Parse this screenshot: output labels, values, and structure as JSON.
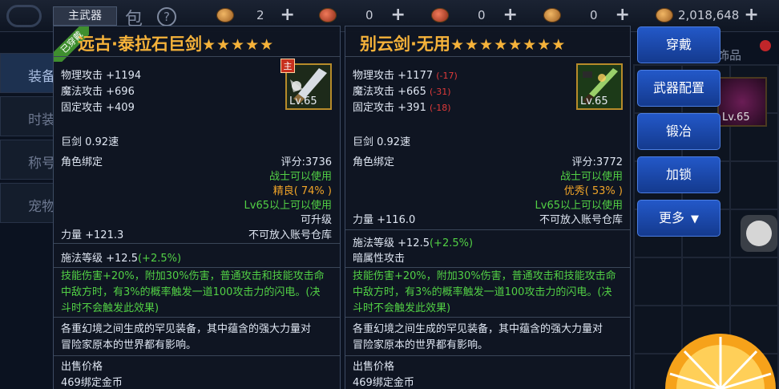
{
  "topbar": {
    "bag_label": "包",
    "help_label": "?",
    "currencies": [
      {
        "value": "2",
        "plus": "+"
      },
      {
        "value": "0",
        "plus": "+"
      },
      {
        "value": "0",
        "plus": "+"
      },
      {
        "value": "0",
        "plus": "+"
      },
      {
        "value": "2,018,648",
        "plus": "+"
      }
    ]
  },
  "leftnav": {
    "tabs": [
      {
        "label": "装备"
      },
      {
        "label": "时装"
      },
      {
        "label": "称号"
      },
      {
        "label": "宠物"
      }
    ]
  },
  "background": {
    "tag": "饰品",
    "item_level": "Lv.65"
  },
  "equipped_tab": "主武器",
  "left_item": {
    "ribbon": "已穿戴",
    "name": "远古·泰拉石巨剑",
    "stars": "★★★★★",
    "main_badge": "主",
    "level": "Lv.65",
    "stats": [
      "物理攻击 +1194",
      "魔法攻击 +696",
      "固定攻击 +409"
    ],
    "weapon_type": "巨剑 0.92速",
    "bind": "角色绑定",
    "score": "评分:3736",
    "class_req": "战士可以使用",
    "quality": "精良( 74% )",
    "level_req": "Lv65以上可以使用",
    "upgradable": "可升级",
    "str": "力量 +121.3",
    "no_store": "不可放入账号仓库",
    "cast_label": "施法等级 +12.5",
    "cast_bonus": "(+2.5%)",
    "skill_lines": [
      "技能伤害+20%，附加30%伤害，普通攻击和技能攻击命",
      "中敌方时，有3%的概率触发一道100攻击力的闪电。(决",
      "斗时不会触发此效果)"
    ],
    "lore_lines": [
      "各重幻境之间生成的罕见装备，其中蕴含的强大力量对",
      "冒险家原本的世界都有影响。"
    ],
    "sell_label": "出售价格",
    "sell_value": "469绑定金币"
  },
  "right_item": {
    "name": "别云剑·无用",
    "stars": "★★★★★★★★",
    "level": "Lv.65",
    "stats": [
      {
        "text": "物理攻击 +1177",
        "diff": "(-17)"
      },
      {
        "text": "魔法攻击 +665",
        "diff": "(-31)"
      },
      {
        "text": "固定攻击 +391",
        "diff": "(-18)"
      }
    ],
    "weapon_type": "巨剑 0.92速",
    "bind": "角色绑定",
    "score": "评分:3772",
    "class_req": "战士可以使用",
    "quality": "优秀( 53% )",
    "level_req": "Lv65以上可以使用",
    "str": "力量 +116.0",
    "no_store": "不可放入账号仓库",
    "cast_label": "施法等级 +12.5",
    "cast_bonus": "(+2.5%)",
    "element": "暗属性攻击",
    "skill_lines": [
      "技能伤害+20%，附加30%伤害，普通攻击和技能攻击命",
      "中敌方时，有3%的概率触发一道100攻击力的闪电。(决",
      "斗时不会触发此效果)"
    ],
    "lore_lines": [
      "各重幻境之间生成的罕见装备，其中蕴含的强大力量对",
      "冒险家原本的世界都有影响。"
    ],
    "sell_label": "出售价格",
    "sell_value": "469绑定金币"
  },
  "buttons": {
    "wear": "穿戴",
    "weapon_config": "武器配置",
    "forge": "锻冶",
    "lock": "加锁",
    "more": "更多",
    "more_arrow": "▼"
  },
  "colors": {
    "title_gold": "#f5b23a",
    "stat_green": "#52d045",
    "quality_orange": "#f0a428",
    "diff_red": "#e03a3a",
    "button_blue": "#2358c8"
  }
}
